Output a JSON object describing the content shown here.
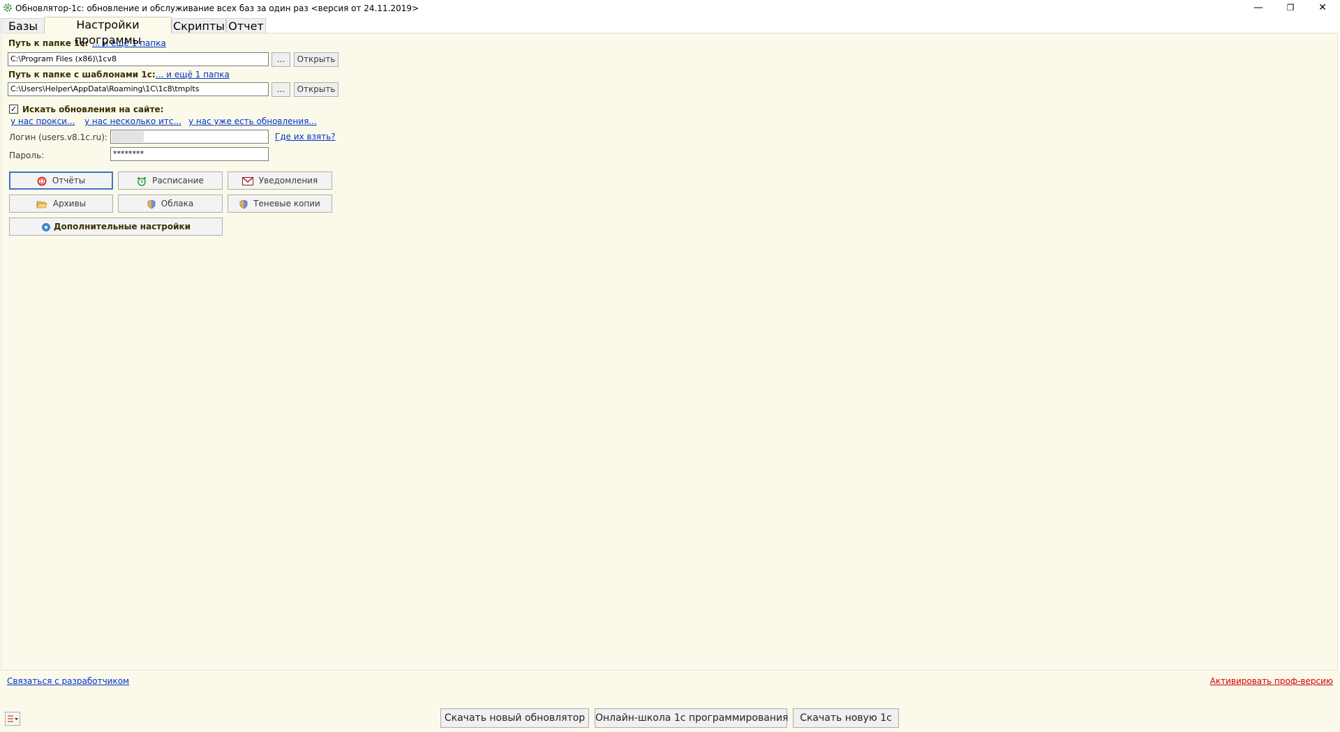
{
  "window": {
    "title": "Обновлятор-1с: обновление и обслуживание всех баз за один раз <версия от 24.11.2019>",
    "minimize": "—",
    "restore": "❐",
    "close": "✕"
  },
  "tabs": [
    {
      "label": "Базы"
    },
    {
      "label": "Настройки программы"
    },
    {
      "label": "Скрипты"
    },
    {
      "label": "Отчет"
    }
  ],
  "settings": {
    "path1c_label": "Путь к папке 1с:",
    "path1c_more": "... и ещё 1 папка",
    "path1c_value": "C:\\Program Files (x86)\\1cv8",
    "browse_label": "...",
    "open_label": "Открыть",
    "templates_label": "Путь к папке с шаблонами 1с:",
    "templates_more": "... и ещё 1 папка",
    "templates_value": "C:\\Users\\Helper\\AppData\\Roaming\\1C\\1c8\\tmplts",
    "check_updates_label": "Искать обновления на сайте:",
    "check_updates_checked": true,
    "link_proxy": "у нас прокси...",
    "link_multi_its": "у нас несколько итс...",
    "link_have_updates": "у нас уже есть обновления...",
    "login_label": "Логин (users.v8.1c.ru):",
    "login_value": "",
    "where_get_link": "Где их взять?",
    "password_label": "Пароль:",
    "password_value": "********"
  },
  "buttons": {
    "reports": "Отчёты",
    "schedule": "Расписание",
    "notifications": "Уведомления",
    "archives": "Архивы",
    "clouds": "Облака",
    "shadow_copies": "Теневые копии",
    "advanced": "Дополнительные настройки"
  },
  "footer": {
    "contact_dev": "Связаться с разработчиком",
    "activate_pro": "Активировать проф-версию",
    "download_updater": "Скачать новый обновлятор",
    "online_school": "Онлайн-школа 1с программирования",
    "download_1c": "Скачать новую 1с"
  },
  "colors": {
    "panel_bg": "#fbf9ea",
    "link": "#0033cc",
    "pro_link": "#d00000",
    "focus_border": "#3a74c9"
  }
}
